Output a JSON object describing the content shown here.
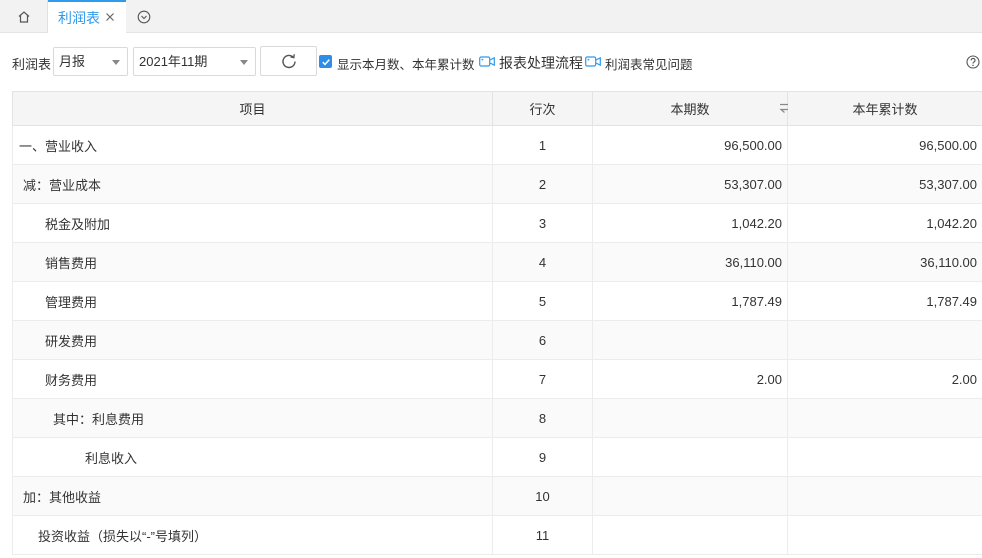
{
  "tabs": {
    "home_icon": "home-icon",
    "active_label": "利润表",
    "close_icon": "close-icon",
    "more_icon": "chevron-down-circle-icon",
    "accent": "#2e9aeb"
  },
  "toolbar": {
    "report_label": "利润表",
    "period_select": "月报",
    "month_select": "2021年11期",
    "refresh_icon": "refresh-icon",
    "show_checkbox_checked": true,
    "show_checkbox_label": "显示本月数、本年累计数",
    "link_process": "报表处理流程",
    "link_faq": "利润表常见问题",
    "video_icon": "video-icon",
    "help_icon": "help-icon"
  },
  "table": {
    "headers": [
      "项目",
      "行次",
      "本期数",
      "本年累计数"
    ],
    "swap_icon": "swap-icon",
    "rows": [
      {
        "item": "一、营业收入",
        "line": "1",
        "current": "96,500.00",
        "ytd": "96,500.00"
      },
      {
        "item": "减：营业成本",
        "line": "2",
        "current": "53,307.00",
        "ytd": "53,307.00"
      },
      {
        "item": "税金及附加",
        "line": "3",
        "current": "1,042.20",
        "ytd": "1,042.20"
      },
      {
        "item": "销售费用",
        "line": "4",
        "current": "36,110.00",
        "ytd": "36,110.00"
      },
      {
        "item": "管理费用",
        "line": "5",
        "current": "1,787.49",
        "ytd": "1,787.49"
      },
      {
        "item": "研发费用",
        "line": "6",
        "current": "",
        "ytd": ""
      },
      {
        "item": "财务费用",
        "line": "7",
        "current": "2.00",
        "ytd": "2.00"
      },
      {
        "item": "其中：利息费用",
        "line": "8",
        "current": "",
        "ytd": ""
      },
      {
        "item": "利息收入",
        "line": "9",
        "current": "",
        "ytd": ""
      },
      {
        "item": "加：其他收益",
        "line": "10",
        "current": "",
        "ytd": ""
      },
      {
        "item": "投资收益（损失以“-”号填列）",
        "line": "11",
        "current": "",
        "ytd": ""
      }
    ]
  }
}
